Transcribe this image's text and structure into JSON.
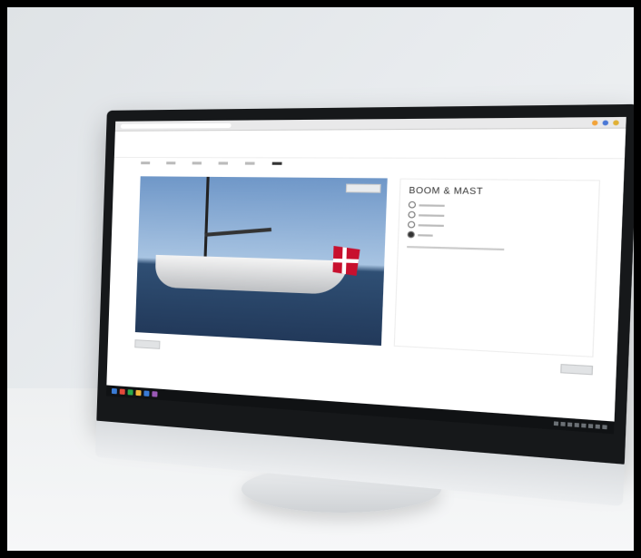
{
  "scene": {
    "background_color": "#e9ecef",
    "device": "desktop-monitor"
  },
  "screen": {
    "panel_title": "BOOM & MAST",
    "colors": {
      "flag_red": "#c8102e",
      "sky": "#6f97c8",
      "sea": "#22395a"
    },
    "options": [
      {
        "selected": false
      },
      {
        "selected": false
      },
      {
        "selected": false
      },
      {
        "selected": true
      }
    ]
  }
}
